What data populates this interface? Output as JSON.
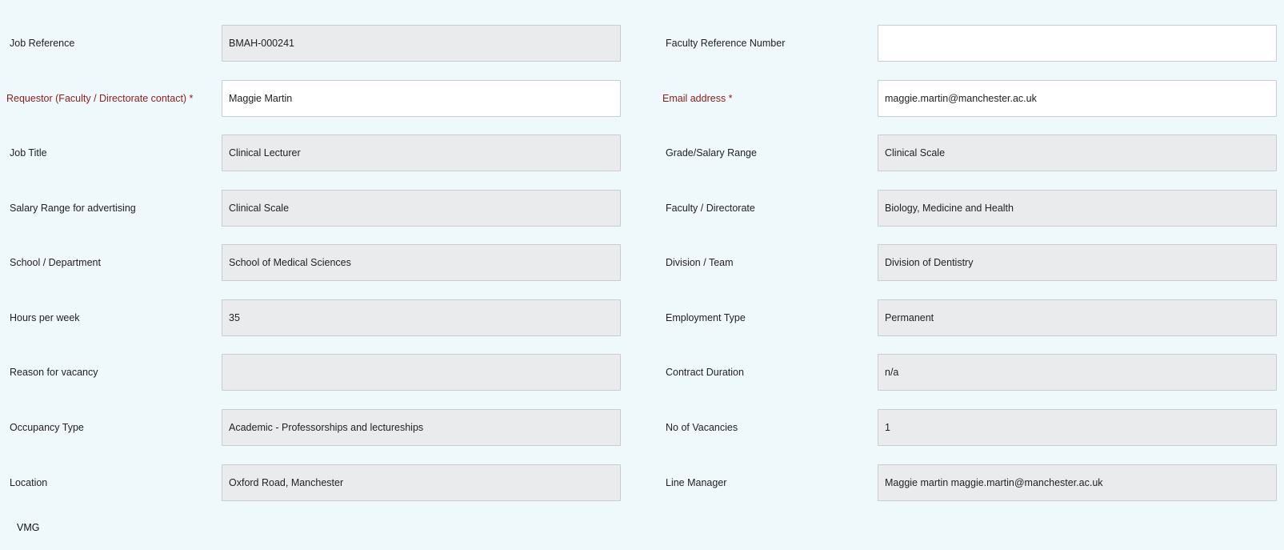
{
  "rows": [
    {
      "left": {
        "label": "Job Reference",
        "value": "BMAH-000241"
      },
      "right": {
        "label": "Faculty Reference Number",
        "value": ""
      }
    },
    {
      "left": {
        "label": "Requestor (Faculty / Directorate contact) *",
        "value": "Maggie Martin"
      },
      "right": {
        "label": "Email address *",
        "value": "maggie.martin@manchester.ac.uk"
      }
    },
    {
      "left": {
        "label": "Job Title",
        "value": "Clinical Lecturer"
      },
      "right": {
        "label": "Grade/Salary Range",
        "value": "Clinical Scale"
      }
    },
    {
      "left": {
        "label": "Salary Range for advertising",
        "value": "Clinical Scale"
      },
      "right": {
        "label": "Faculty / Directorate",
        "value": "Biology, Medicine and Health"
      }
    },
    {
      "left": {
        "label": "School / Department",
        "value": "School of Medical Sciences"
      },
      "right": {
        "label": "Division / Team",
        "value": "Division of Dentistry"
      }
    },
    {
      "left": {
        "label": "Hours per week",
        "value": "35"
      },
      "right": {
        "label": "Employment Type",
        "value": "Permanent"
      }
    },
    {
      "left": {
        "label": "Reason for vacancy",
        "value": ""
      },
      "right": {
        "label": "Contract Duration",
        "value": "n/a"
      }
    },
    {
      "left": {
        "label": "Occupancy Type",
        "value": "Academic - Professorships and lectureships"
      },
      "right": {
        "label": "No of Vacancies",
        "value": "1"
      }
    },
    {
      "left": {
        "label": "Location",
        "value": "Oxford Road, Manchester"
      },
      "right": {
        "label": "Line Manager",
        "value": "Maggie martin  maggie.martin@manchester.ac.uk"
      }
    }
  ],
  "footer": {
    "section_label": "VMG"
  },
  "colors": {
    "background": "#eff8fb",
    "required_label": "#8b1d1d",
    "readonly_field": "#e9ebed",
    "editable_field": "#ffffff",
    "field_border": "#c9cdd1"
  }
}
